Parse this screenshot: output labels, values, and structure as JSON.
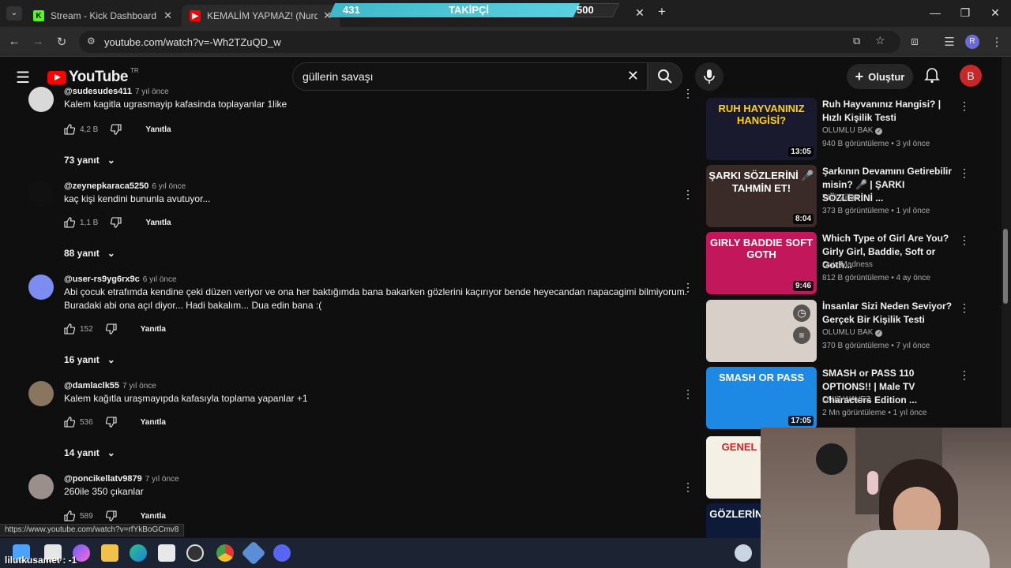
{
  "browser": {
    "tabs": [
      {
        "label": "Stream - Kick Dashboard"
      },
      {
        "label": "KEMALİM YAPMAZ! (Nurdisina"
      }
    ],
    "url": "youtube.com/watch?v=-Wh2TZuQD_w",
    "status_url": "https://www.youtube.com/watch?v=rfYkBoGCmv8"
  },
  "overlay": {
    "follower_current": "431",
    "follower_label": "TAKİPÇİ",
    "follower_goal": "500",
    "follower_progress": 0.86,
    "bottom_text": "lilutkusamet : -1"
  },
  "youtube": {
    "logo_text": "YouTube",
    "country": "TR",
    "search_value": "güllerin savaşı",
    "create_label": "Oluştur",
    "avatar_letter": "B"
  },
  "comments": [
    {
      "handle": "@sudesudes411",
      "time": "7 yıl önce",
      "text": "Kalem kagitla ugrasmayip kafasinda toplayanlar 1like",
      "likes": "4,2 B",
      "reply": "Yanıtla",
      "replies": "73 yanıt",
      "avatar_color": "#d9d9d9"
    },
    {
      "handle": "@zeynepkaraca5250",
      "time": "6 yıl önce",
      "text": "kaç kişi kendini bununla avutuyor...",
      "likes": "1,1 B",
      "reply": "Yanıtla",
      "replies": "88 yanıt",
      "avatar_color": "#111111"
    },
    {
      "handle": "@user-rs9yg6rx9c",
      "time": "6 yıl önce",
      "text": "Abi çocuk etrafımda kendine çeki düzen veriyor ve ona her baktığımda bana bakarken gözlerini kaçırıyor bende heyecandan napacagimi bilmiyorum. Buradaki abi ona açıl diyor... Hadi bakalım... Dua edin bana :(",
      "likes": "152",
      "reply": "Yanıtla",
      "replies": "16 yanıt",
      "avatar_color": "#7c8cf0"
    },
    {
      "handle": "@damlaclk55",
      "time": "7 yıl önce",
      "text": "Kalem kağıtla uraşmayıpda kafasıyla toplama yapanlar +1",
      "likes": "536",
      "reply": "Yanıtla",
      "replies": "14 yanıt",
      "avatar_color": "#8a7560"
    },
    {
      "handle": "@poncikellatv9879",
      "time": "7 yıl önce",
      "text": "260ile 350 çıkanlar",
      "likes": "589",
      "reply": "Yanıtla",
      "replies": "",
      "avatar_color": "#9a8f8a"
    }
  ],
  "sidebar": [
    {
      "title": "Ruh Hayvanınız Hangisi? | Hızlı Kişilik Testi",
      "channel": "OLUMLU BAK",
      "verified": true,
      "meta": "940 B görüntüleme • 3 yıl önce",
      "duration": "13:05",
      "thumb_text": "RUH HAYVANINIZ HANGİSİ?",
      "thumb_bg": "#1a1a2e",
      "thumb_fg": "#ffd400"
    },
    {
      "title": "Şarkının Devamını Getirebilir misin? 🎤 | ŞARKI SÖZLERİNİ ...",
      "channel": "Türk Zillaz",
      "verified": false,
      "meta": "373 B görüntüleme • 1 yıl önce",
      "duration": "8:04",
      "thumb_text": "ŞARKI SÖZLERİNİ 🎤 TAHMİN ET!",
      "thumb_bg": "#3a2a28",
      "thumb_fg": "#ffffff"
    },
    {
      "title": "Which Type of Girl Are You? Girly Girl, Baddie, Soft or Goth...",
      "channel": "Quiz Madness",
      "verified": false,
      "meta": "812 B görüntüleme • 4 ay önce",
      "duration": "9:46",
      "thumb_text": "GIRLY BADDIE SOFT GOTH",
      "thumb_bg": "#c2185b",
      "thumb_fg": "#ffffff"
    },
    {
      "title": "İnsanlar Sizi Neden Seviyor? Gerçek Bir Kişilik Testi",
      "channel": "OLUMLU BAK",
      "verified": true,
      "meta": "370 B görüntüleme • 7 yıl önce",
      "duration": "",
      "thumb_text": "",
      "thumb_bg": "#d8d0c8",
      "thumb_fg": "#ffffff"
    },
    {
      "title": "SMASH or PASS 110 OPTIONS!! | Male TV Characters Edition ...",
      "channel": "QUIZ WAVEZ",
      "verified": false,
      "meta": "2 Mn görüntüleme • 1 yıl önce",
      "duration": "17:05",
      "thumb_text": "SMASH OR PASS",
      "thumb_bg": "#1e88e5",
      "thumb_fg": "#ffffff"
    },
    {
      "title": "",
      "channel": "",
      "verified": false,
      "meta": "",
      "duration": "",
      "thumb_text": "GENEL KÜLTÜR",
      "thumb_bg": "#f5f0e6",
      "thumb_fg": "#c62828"
    },
    {
      "title": "",
      "channel": "",
      "verified": false,
      "meta": "",
      "duration": "",
      "thumb_text": "GÖZLERİNİZ İYİ GÖR",
      "thumb_bg": "#0d1a3a",
      "thumb_fg": "#ffffff"
    }
  ]
}
